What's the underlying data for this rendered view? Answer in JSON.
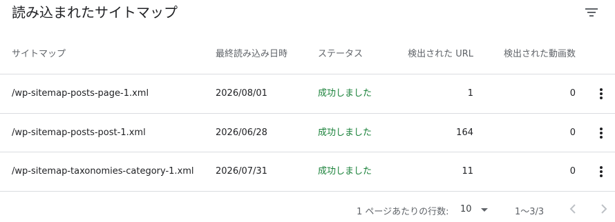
{
  "page": {
    "title": "読み込まれたサイトマップ"
  },
  "table": {
    "columns": {
      "sitemap": "サイトマップ",
      "last_read": "最終読み込み日時",
      "status": "ステータス",
      "urls": "検出された URL",
      "videos": "検出された動画数"
    },
    "rows": [
      {
        "path": "/wp-sitemap-posts-page-1.xml",
        "date": "2026/08/01",
        "status": "成功しました",
        "urls": "1",
        "videos": "0"
      },
      {
        "path": "/wp-sitemap-posts-post-1.xml",
        "date": "2026/06/28",
        "status": "成功しました",
        "urls": "164",
        "videos": "0"
      },
      {
        "path": "/wp-sitemap-taxonomies-category-1.xml",
        "date": "2026/07/31",
        "status": "成功しました",
        "urls": "11",
        "videos": "0"
      }
    ]
  },
  "pagination": {
    "rows_per_page_label": "1 ページあたりの行数:",
    "rows_per_page_value": "10",
    "range": "1〜3/3"
  },
  "icons": {
    "filter": "filter-icon",
    "more": "more-vert-icon",
    "prev": "chevron-left-icon",
    "next": "chevron-right-icon",
    "dropdown": "caret-down-icon"
  },
  "colors": {
    "success": "#188038",
    "muted": "#5f6368",
    "divider": "#dadce0"
  }
}
